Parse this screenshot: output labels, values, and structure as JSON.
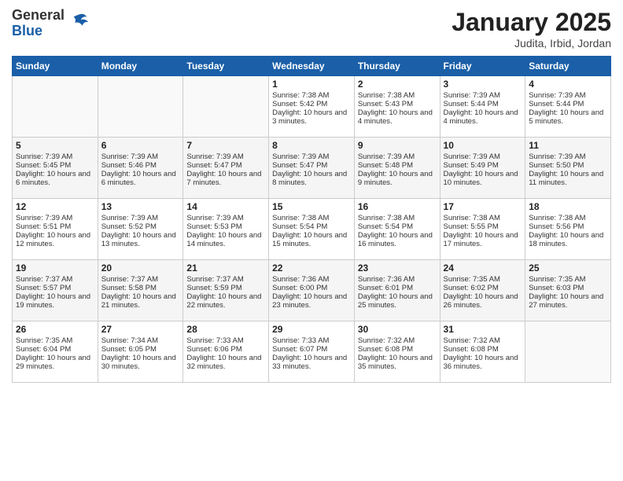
{
  "logo": {
    "general": "General",
    "blue": "Blue"
  },
  "header": {
    "title": "January 2025",
    "subtitle": "Judita, Irbid, Jordan"
  },
  "weekdays": [
    "Sunday",
    "Monday",
    "Tuesday",
    "Wednesday",
    "Thursday",
    "Friday",
    "Saturday"
  ],
  "weeks": [
    [
      {
        "num": "",
        "sunrise": "",
        "sunset": "",
        "daylight": ""
      },
      {
        "num": "",
        "sunrise": "",
        "sunset": "",
        "daylight": ""
      },
      {
        "num": "",
        "sunrise": "",
        "sunset": "",
        "daylight": ""
      },
      {
        "num": "1",
        "sunrise": "Sunrise: 7:38 AM",
        "sunset": "Sunset: 5:42 PM",
        "daylight": "Daylight: 10 hours and 3 minutes."
      },
      {
        "num": "2",
        "sunrise": "Sunrise: 7:38 AM",
        "sunset": "Sunset: 5:43 PM",
        "daylight": "Daylight: 10 hours and 4 minutes."
      },
      {
        "num": "3",
        "sunrise": "Sunrise: 7:39 AM",
        "sunset": "Sunset: 5:44 PM",
        "daylight": "Daylight: 10 hours and 4 minutes."
      },
      {
        "num": "4",
        "sunrise": "Sunrise: 7:39 AM",
        "sunset": "Sunset: 5:44 PM",
        "daylight": "Daylight: 10 hours and 5 minutes."
      }
    ],
    [
      {
        "num": "5",
        "sunrise": "Sunrise: 7:39 AM",
        "sunset": "Sunset: 5:45 PM",
        "daylight": "Daylight: 10 hours and 6 minutes."
      },
      {
        "num": "6",
        "sunrise": "Sunrise: 7:39 AM",
        "sunset": "Sunset: 5:46 PM",
        "daylight": "Daylight: 10 hours and 6 minutes."
      },
      {
        "num": "7",
        "sunrise": "Sunrise: 7:39 AM",
        "sunset": "Sunset: 5:47 PM",
        "daylight": "Daylight: 10 hours and 7 minutes."
      },
      {
        "num": "8",
        "sunrise": "Sunrise: 7:39 AM",
        "sunset": "Sunset: 5:47 PM",
        "daylight": "Daylight: 10 hours and 8 minutes."
      },
      {
        "num": "9",
        "sunrise": "Sunrise: 7:39 AM",
        "sunset": "Sunset: 5:48 PM",
        "daylight": "Daylight: 10 hours and 9 minutes."
      },
      {
        "num": "10",
        "sunrise": "Sunrise: 7:39 AM",
        "sunset": "Sunset: 5:49 PM",
        "daylight": "Daylight: 10 hours and 10 minutes."
      },
      {
        "num": "11",
        "sunrise": "Sunrise: 7:39 AM",
        "sunset": "Sunset: 5:50 PM",
        "daylight": "Daylight: 10 hours and 11 minutes."
      }
    ],
    [
      {
        "num": "12",
        "sunrise": "Sunrise: 7:39 AM",
        "sunset": "Sunset: 5:51 PM",
        "daylight": "Daylight: 10 hours and 12 minutes."
      },
      {
        "num": "13",
        "sunrise": "Sunrise: 7:39 AM",
        "sunset": "Sunset: 5:52 PM",
        "daylight": "Daylight: 10 hours and 13 minutes."
      },
      {
        "num": "14",
        "sunrise": "Sunrise: 7:39 AM",
        "sunset": "Sunset: 5:53 PM",
        "daylight": "Daylight: 10 hours and 14 minutes."
      },
      {
        "num": "15",
        "sunrise": "Sunrise: 7:38 AM",
        "sunset": "Sunset: 5:54 PM",
        "daylight": "Daylight: 10 hours and 15 minutes."
      },
      {
        "num": "16",
        "sunrise": "Sunrise: 7:38 AM",
        "sunset": "Sunset: 5:54 PM",
        "daylight": "Daylight: 10 hours and 16 minutes."
      },
      {
        "num": "17",
        "sunrise": "Sunrise: 7:38 AM",
        "sunset": "Sunset: 5:55 PM",
        "daylight": "Daylight: 10 hours and 17 minutes."
      },
      {
        "num": "18",
        "sunrise": "Sunrise: 7:38 AM",
        "sunset": "Sunset: 5:56 PM",
        "daylight": "Daylight: 10 hours and 18 minutes."
      }
    ],
    [
      {
        "num": "19",
        "sunrise": "Sunrise: 7:37 AM",
        "sunset": "Sunset: 5:57 PM",
        "daylight": "Daylight: 10 hours and 19 minutes."
      },
      {
        "num": "20",
        "sunrise": "Sunrise: 7:37 AM",
        "sunset": "Sunset: 5:58 PM",
        "daylight": "Daylight: 10 hours and 21 minutes."
      },
      {
        "num": "21",
        "sunrise": "Sunrise: 7:37 AM",
        "sunset": "Sunset: 5:59 PM",
        "daylight": "Daylight: 10 hours and 22 minutes."
      },
      {
        "num": "22",
        "sunrise": "Sunrise: 7:36 AM",
        "sunset": "Sunset: 6:00 PM",
        "daylight": "Daylight: 10 hours and 23 minutes."
      },
      {
        "num": "23",
        "sunrise": "Sunrise: 7:36 AM",
        "sunset": "Sunset: 6:01 PM",
        "daylight": "Daylight: 10 hours and 25 minutes."
      },
      {
        "num": "24",
        "sunrise": "Sunrise: 7:35 AM",
        "sunset": "Sunset: 6:02 PM",
        "daylight": "Daylight: 10 hours and 26 minutes."
      },
      {
        "num": "25",
        "sunrise": "Sunrise: 7:35 AM",
        "sunset": "Sunset: 6:03 PM",
        "daylight": "Daylight: 10 hours and 27 minutes."
      }
    ],
    [
      {
        "num": "26",
        "sunrise": "Sunrise: 7:35 AM",
        "sunset": "Sunset: 6:04 PM",
        "daylight": "Daylight: 10 hours and 29 minutes."
      },
      {
        "num": "27",
        "sunrise": "Sunrise: 7:34 AM",
        "sunset": "Sunset: 6:05 PM",
        "daylight": "Daylight: 10 hours and 30 minutes."
      },
      {
        "num": "28",
        "sunrise": "Sunrise: 7:33 AM",
        "sunset": "Sunset: 6:06 PM",
        "daylight": "Daylight: 10 hours and 32 minutes."
      },
      {
        "num": "29",
        "sunrise": "Sunrise: 7:33 AM",
        "sunset": "Sunset: 6:07 PM",
        "daylight": "Daylight: 10 hours and 33 minutes."
      },
      {
        "num": "30",
        "sunrise": "Sunrise: 7:32 AM",
        "sunset": "Sunset: 6:08 PM",
        "daylight": "Daylight: 10 hours and 35 minutes."
      },
      {
        "num": "31",
        "sunrise": "Sunrise: 7:32 AM",
        "sunset": "Sunset: 6:08 PM",
        "daylight": "Daylight: 10 hours and 36 minutes."
      },
      {
        "num": "",
        "sunrise": "",
        "sunset": "",
        "daylight": ""
      }
    ]
  ]
}
